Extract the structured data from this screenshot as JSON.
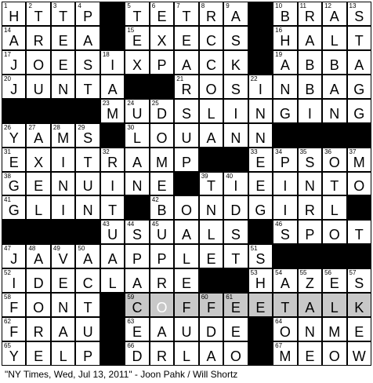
{
  "caption": "\"NY Times, Wed, Jul 13, 2011\" - Joon Pahk / Will Shortz",
  "colors": {
    "grid_lines": "#000000",
    "block": "#000000",
    "cell": "#ffffff",
    "shaded_theme_cell": "#c8c8c8",
    "cursor_cell": "#ffffff"
  },
  "grid": {
    "rows": 15,
    "cols": 15,
    "block_char": "#",
    "solution": [
      "HTTP#TETRA#BRAS",
      "AREA#EXECS#HALT",
      "JOESIXPACK#ABBA",
      "JUNTA##ROSINBAG",
      "####MUDSLINGING",
      "YAMS#LOUANN####",
      "EXITRAMP##EPSOM",
      "GENUINE#TIEINTO",
      "GLINT#BONDGIRL#",
      "####USUALS#SPOT",
      "JAVAAPPLETS####",
      "IDECLARE##HAZES",
      "FONT#COFFEETALK",
      "FRAU#EAUDE#ONME",
      "YELP#DRLAO#MEOW"
    ],
    "numbers": [
      [
        1,
        2,
        3,
        4,
        0,
        5,
        6,
        7,
        8,
        9,
        0,
        10,
        11,
        12,
        13
      ],
      [
        14,
        0,
        0,
        0,
        0,
        15,
        0,
        0,
        0,
        0,
        0,
        16,
        0,
        0,
        0
      ],
      [
        17,
        0,
        0,
        0,
        18,
        0,
        0,
        0,
        0,
        0,
        0,
        19,
        0,
        0,
        0
      ],
      [
        20,
        0,
        0,
        0,
        0,
        0,
        0,
        21,
        0,
        0,
        22,
        0,
        0,
        0,
        0
      ],
      [
        0,
        0,
        0,
        0,
        23,
        24,
        25,
        0,
        0,
        0,
        0,
        0,
        0,
        0,
        0
      ],
      [
        26,
        27,
        28,
        29,
        0,
        30,
        0,
        0,
        0,
        0,
        0,
        0,
        0,
        0,
        0
      ],
      [
        31,
        0,
        0,
        0,
        32,
        0,
        0,
        0,
        0,
        0,
        33,
        34,
        35,
        36,
        37
      ],
      [
        38,
        0,
        0,
        0,
        0,
        0,
        0,
        0,
        39,
        40,
        0,
        0,
        0,
        0,
        0
      ],
      [
        41,
        0,
        0,
        0,
        0,
        0,
        42,
        0,
        0,
        0,
        0,
        0,
        0,
        0,
        0
      ],
      [
        0,
        0,
        0,
        0,
        43,
        44,
        45,
        0,
        0,
        0,
        0,
        46,
        0,
        0,
        0
      ],
      [
        47,
        48,
        49,
        50,
        0,
        0,
        0,
        0,
        0,
        0,
        51,
        0,
        0,
        0,
        0
      ],
      [
        52,
        0,
        0,
        0,
        0,
        0,
        0,
        0,
        0,
        0,
        53,
        54,
        55,
        56,
        57
      ],
      [
        58,
        0,
        0,
        0,
        0,
        59,
        0,
        0,
        60,
        61,
        0,
        0,
        0,
        0,
        0
      ],
      [
        62,
        0,
        0,
        0,
        0,
        63,
        0,
        0,
        0,
        0,
        0,
        64,
        0,
        0,
        0
      ],
      [
        65,
        0,
        0,
        0,
        0,
        66,
        0,
        0,
        0,
        0,
        0,
        67,
        0,
        0,
        0
      ]
    ],
    "shaded_cells": [
      [
        12,
        5
      ],
      [
        12,
        6
      ],
      [
        12,
        7
      ],
      [
        12,
        8
      ],
      [
        12,
        9
      ],
      [
        12,
        10
      ],
      [
        12,
        11
      ],
      [
        12,
        12
      ],
      [
        12,
        13
      ],
      [
        12,
        14
      ]
    ],
    "cursor_cell": [
      12,
      6
    ]
  }
}
